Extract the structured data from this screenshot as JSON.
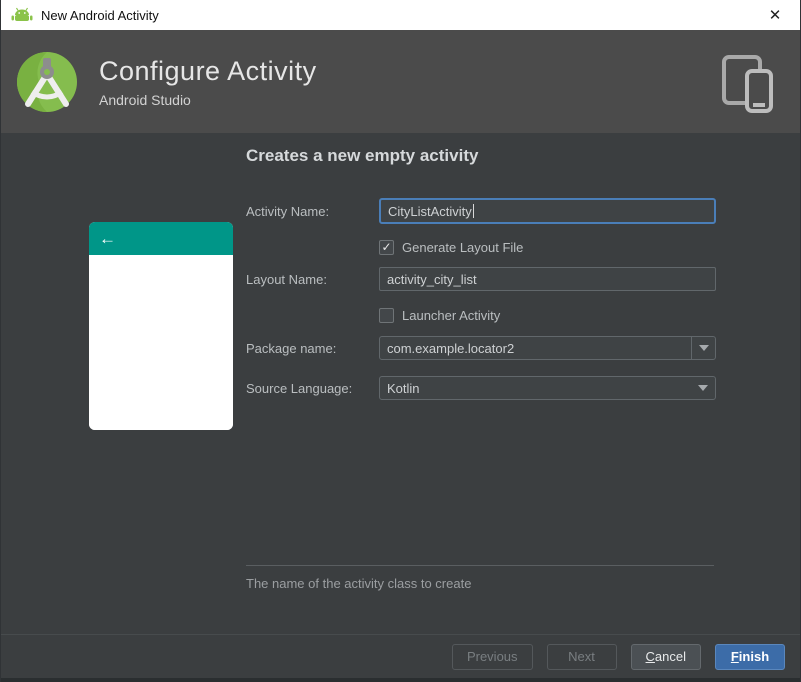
{
  "window": {
    "title": "New Android Activity",
    "close_glyph": "✕"
  },
  "header": {
    "title": "Configure Activity",
    "subtitle": "Android Studio"
  },
  "content": {
    "heading": "Creates a new empty activity",
    "preview": {
      "back_arrow": "←",
      "header_color": "#009688"
    },
    "form": {
      "activity_name": {
        "label": "Activity Name:",
        "value": "CityListActivity",
        "focused": true
      },
      "generate_layout": {
        "label": "Generate Layout File",
        "checked": true
      },
      "layout_name": {
        "label": "Layout Name:",
        "value": "activity_city_list"
      },
      "launcher_activity": {
        "label": "Launcher Activity",
        "checked": false
      },
      "package_name": {
        "label": "Package name:",
        "value": "com.example.locator2"
      },
      "source_language": {
        "label": "Source Language:",
        "value": "Kotlin"
      }
    },
    "hint": "The name of the activity class to create"
  },
  "glyphs": {
    "check": "✓"
  },
  "buttons": {
    "previous": {
      "label": "Previous",
      "enabled": false
    },
    "next": {
      "label": "Next",
      "enabled": false
    },
    "cancel": {
      "mnemonic": "C",
      "rest": "ancel",
      "enabled": true
    },
    "finish": {
      "mnemonic": "F",
      "rest": "inish",
      "enabled": true,
      "default": true
    }
  },
  "colors": {
    "titlebar_bg": "#ffffff",
    "header_bg": "#4b4b4b",
    "content_bg": "#3b3e40",
    "preview_teal": "#009688",
    "android_green": "#8bc34a",
    "focus_blue": "#4a7eb8",
    "finish_blue": "#3c6ca8"
  }
}
